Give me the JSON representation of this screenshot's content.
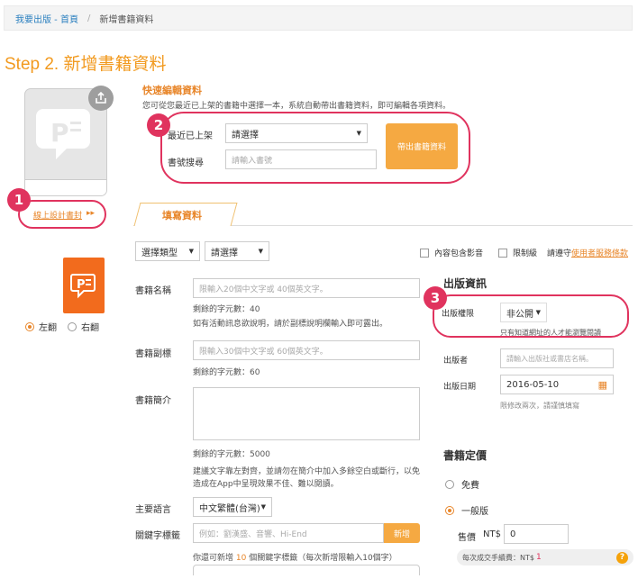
{
  "breadcrumb": {
    "home": "我要出版 - 首頁",
    "separator": "/",
    "current": "新增書籍資料"
  },
  "step_title": "Step 2. 新增書籍資料",
  "cover": {
    "online_design_link": "線上設計書封",
    "arrow": "▸▸"
  },
  "badges": {
    "b1": "1",
    "b2": "2",
    "b3": "3"
  },
  "page_direction": {
    "left": "左翻",
    "right": "右翻"
  },
  "quick_edit": {
    "title": "快速編輯資料",
    "description": "您可從您最近已上架的書籍中選擇一本，系統自動帶出書籍資料，即可編輯各項資料。",
    "recent_label": "最近已上架",
    "recent_select": "請選擇",
    "search_label": "書號搜尋",
    "search_placeholder": "請輸入書號",
    "fill_button": "帶出書籍資料"
  },
  "fill_tab": "填寫資料",
  "filters": {
    "type_select": "選擇類型",
    "sub_select": "請選擇"
  },
  "options": {
    "media": "內容包含影音",
    "restricted": "限制級",
    "terms_prefix": "請遵守",
    "terms_link": "使用者服務條款"
  },
  "book_name": {
    "label": "書籍名稱",
    "placeholder": "限輸入20個中文字或 40個英文字。",
    "remaining": "剩餘的字元數：40",
    "note": "如有活動訊息欲說明，請於副標說明欄輸入即可露出。"
  },
  "subtitle": {
    "label": "書籍副標",
    "placeholder": "限輸入30個中文字或 60個英文字。",
    "remaining": "剩餘的字元數：60"
  },
  "intro": {
    "label": "書籍簡介",
    "remaining": "剩餘的字元數：5000",
    "note1": "建議文字靠左對齊，並請勿在簡介中加入多餘空白或斷行，以免",
    "note2": "造成在App中呈現效果不佳、難以閱讀。"
  },
  "language": {
    "label": "主要語言",
    "value": "中文繁體(台灣)"
  },
  "keywords": {
    "label": "關鍵字標籤",
    "placeholder": "例如：劉漢盛、音響、Hi-End",
    "add_button": "新增",
    "note_prefix": "你還可新增",
    "count": "10",
    "note_suffix": "個關鍵字標籤（每次新增限輸入10個字）"
  },
  "publish": {
    "title": "出版資訊",
    "permission_label": "出版權限",
    "permission_value": "非公開",
    "permission_hint": "只有知道網址的人才能瀏覽閱讀",
    "publisher_label": "出版者",
    "publisher_placeholder": "請輸入出版社或書店名稱。",
    "date_label": "出版日期",
    "date_value": "2016-05-10",
    "date_hint": "限修改兩次，請謹慎填寫"
  },
  "pricing": {
    "title": "書籍定價",
    "free": "免費",
    "normal": "一般版",
    "price_label": "售價",
    "currency": "NT$",
    "price_value": "0",
    "fee_label": "每次成交手續費：NT$",
    "fee_value": "1",
    "help": "?"
  }
}
